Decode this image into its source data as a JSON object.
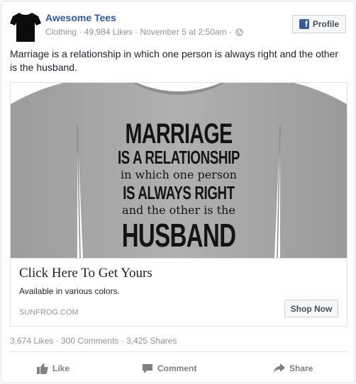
{
  "post": {
    "page_name": "Awesome Tees",
    "category": "Clothing",
    "likes": "49,984 Likes",
    "date": "November 5 at 2:50am",
    "separator": "·",
    "profile_button": "Profile",
    "text": "Marriage is a relationship in which one person is always right and the other is the husband."
  },
  "shirt": {
    "line1": "MARRIAGE",
    "line2": "IS A RELATIONSHIP",
    "line3": "in which one person",
    "line4": "IS ALWAYS RIGHT",
    "line5": "and the other is the",
    "line6": "HUSBAND"
  },
  "attachment": {
    "title": "Click Here To Get Yours",
    "description": "Available in various colors.",
    "domain": "SUNFROG.COM",
    "cta": "Shop Now"
  },
  "stats": {
    "text": "3,674 Likes · 300 Comments · 3,425 Shares"
  },
  "actions": {
    "like": "Like",
    "comment": "Comment",
    "share": "Share"
  },
  "colors": {
    "link_blue": "#365899",
    "fb_blue": "#3b5998",
    "meta_gray": "#90949c",
    "shirt_gray": "#a9a9a9"
  },
  "icons": [
    "tshirt-avatar-icon",
    "globe-icon",
    "facebook-f-icon",
    "thumbs-up-icon",
    "comment-bubble-icon",
    "share-arrow-icon"
  ]
}
